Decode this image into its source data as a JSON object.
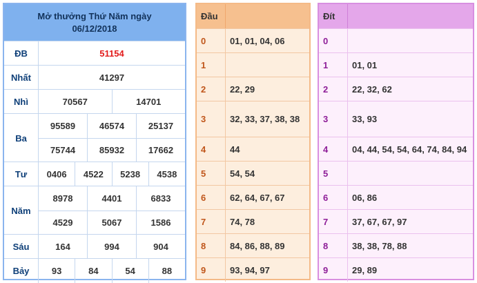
{
  "results": {
    "title_line1": "Mở thưởng Thứ Năm ngày",
    "title_line2": "06/12/2018",
    "prizes": [
      {
        "label": "ĐB",
        "lines": [
          [
            "51154"
          ]
        ],
        "special": true
      },
      {
        "label": "Nhất",
        "lines": [
          [
            "41297"
          ]
        ]
      },
      {
        "label": "Nhì",
        "lines": [
          [
            "70567",
            "14701"
          ]
        ]
      },
      {
        "label": "Ba",
        "lines": [
          [
            "95589",
            "46574",
            "25137"
          ],
          [
            "75744",
            "85932",
            "17662"
          ]
        ]
      },
      {
        "label": "Tư",
        "lines": [
          [
            "0406",
            "4522",
            "5238",
            "4538"
          ]
        ]
      },
      {
        "label": "Năm",
        "lines": [
          [
            "8978",
            "4401",
            "6833"
          ],
          [
            "4529",
            "5067",
            "1586"
          ]
        ]
      },
      {
        "label": "Sáu",
        "lines": [
          [
            "164",
            "994",
            "904"
          ]
        ]
      },
      {
        "label": "Bảy",
        "lines": [
          [
            "93",
            "84",
            "54",
            "88"
          ]
        ]
      }
    ]
  },
  "dau": {
    "header": "Đầu",
    "rows": [
      {
        "k": "0",
        "v": "01, 01, 04, 06"
      },
      {
        "k": "1",
        "v": ""
      },
      {
        "k": "2",
        "v": "22, 29"
      },
      {
        "k": "3",
        "v": "32, 33, 37, 38, 38"
      },
      {
        "k": "4",
        "v": "44"
      },
      {
        "k": "5",
        "v": "54, 54"
      },
      {
        "k": "6",
        "v": "62, 64, 67, 67"
      },
      {
        "k": "7",
        "v": "74, 78"
      },
      {
        "k": "8",
        "v": "84, 86, 88, 89"
      },
      {
        "k": "9",
        "v": "93, 94, 97"
      }
    ]
  },
  "dit": {
    "header": "Đít",
    "rows": [
      {
        "k": "0",
        "v": ""
      },
      {
        "k": "1",
        "v": "01, 01"
      },
      {
        "k": "2",
        "v": "22, 32, 62"
      },
      {
        "k": "3",
        "v": "33, 93"
      },
      {
        "k": "4",
        "v": "04, 44, 54, 54, 64, 74, 84, 94"
      },
      {
        "k": "5",
        "v": ""
      },
      {
        "k": "6",
        "v": "06, 86"
      },
      {
        "k": "7",
        "v": "37, 67, 67, 97"
      },
      {
        "k": "8",
        "v": "38, 38, 78, 88"
      },
      {
        "k": "9",
        "v": "29, 89"
      }
    ]
  },
  "colors": {
    "results_header": "#7fb1ee",
    "special_prize": "#e21b1b",
    "dau_header": "#f6c08f",
    "dit_header": "#e4a7ea"
  }
}
